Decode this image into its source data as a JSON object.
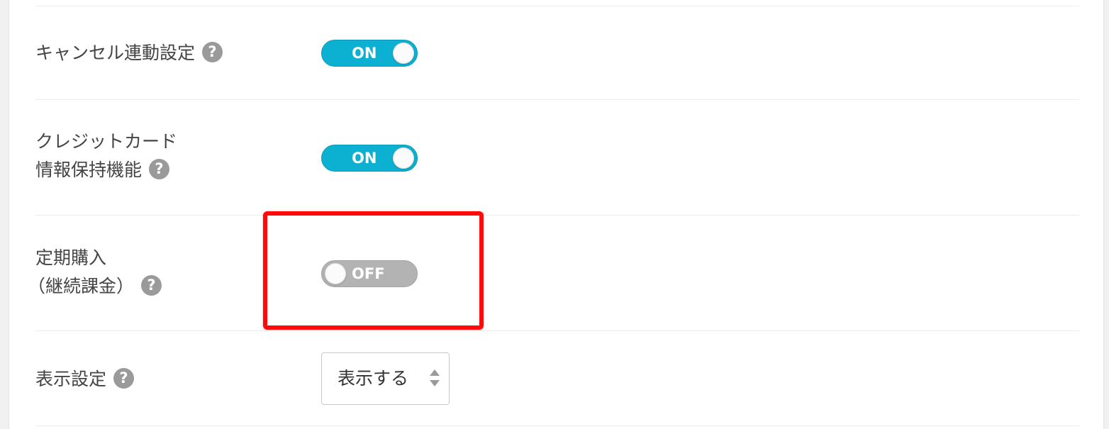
{
  "settings": {
    "cancel_link": {
      "label": "キャンセル連動設定",
      "help_icon": "question-circle-icon",
      "toggle_state": "ON"
    },
    "credit_card_retention": {
      "label_line1": "クレジットカード",
      "label_line2": "情報保持機能",
      "help_icon": "question-circle-icon",
      "toggle_state": "ON"
    },
    "subscription": {
      "label_line1": "定期購入",
      "label_line2": "（継続課金）",
      "help_icon": "question-circle-icon",
      "toggle_state": "OFF",
      "highlighted": true
    },
    "display": {
      "label": "表示設定",
      "help_icon": "question-circle-icon",
      "selected_value": "表示する",
      "control_icon": "updown-arrows-icon"
    }
  },
  "colors": {
    "toggle_on": "#0cb0d0",
    "toggle_off": "#b3b3b3",
    "highlight_border": "#ff0a0a",
    "help_icon": "#9a9a9a"
  }
}
